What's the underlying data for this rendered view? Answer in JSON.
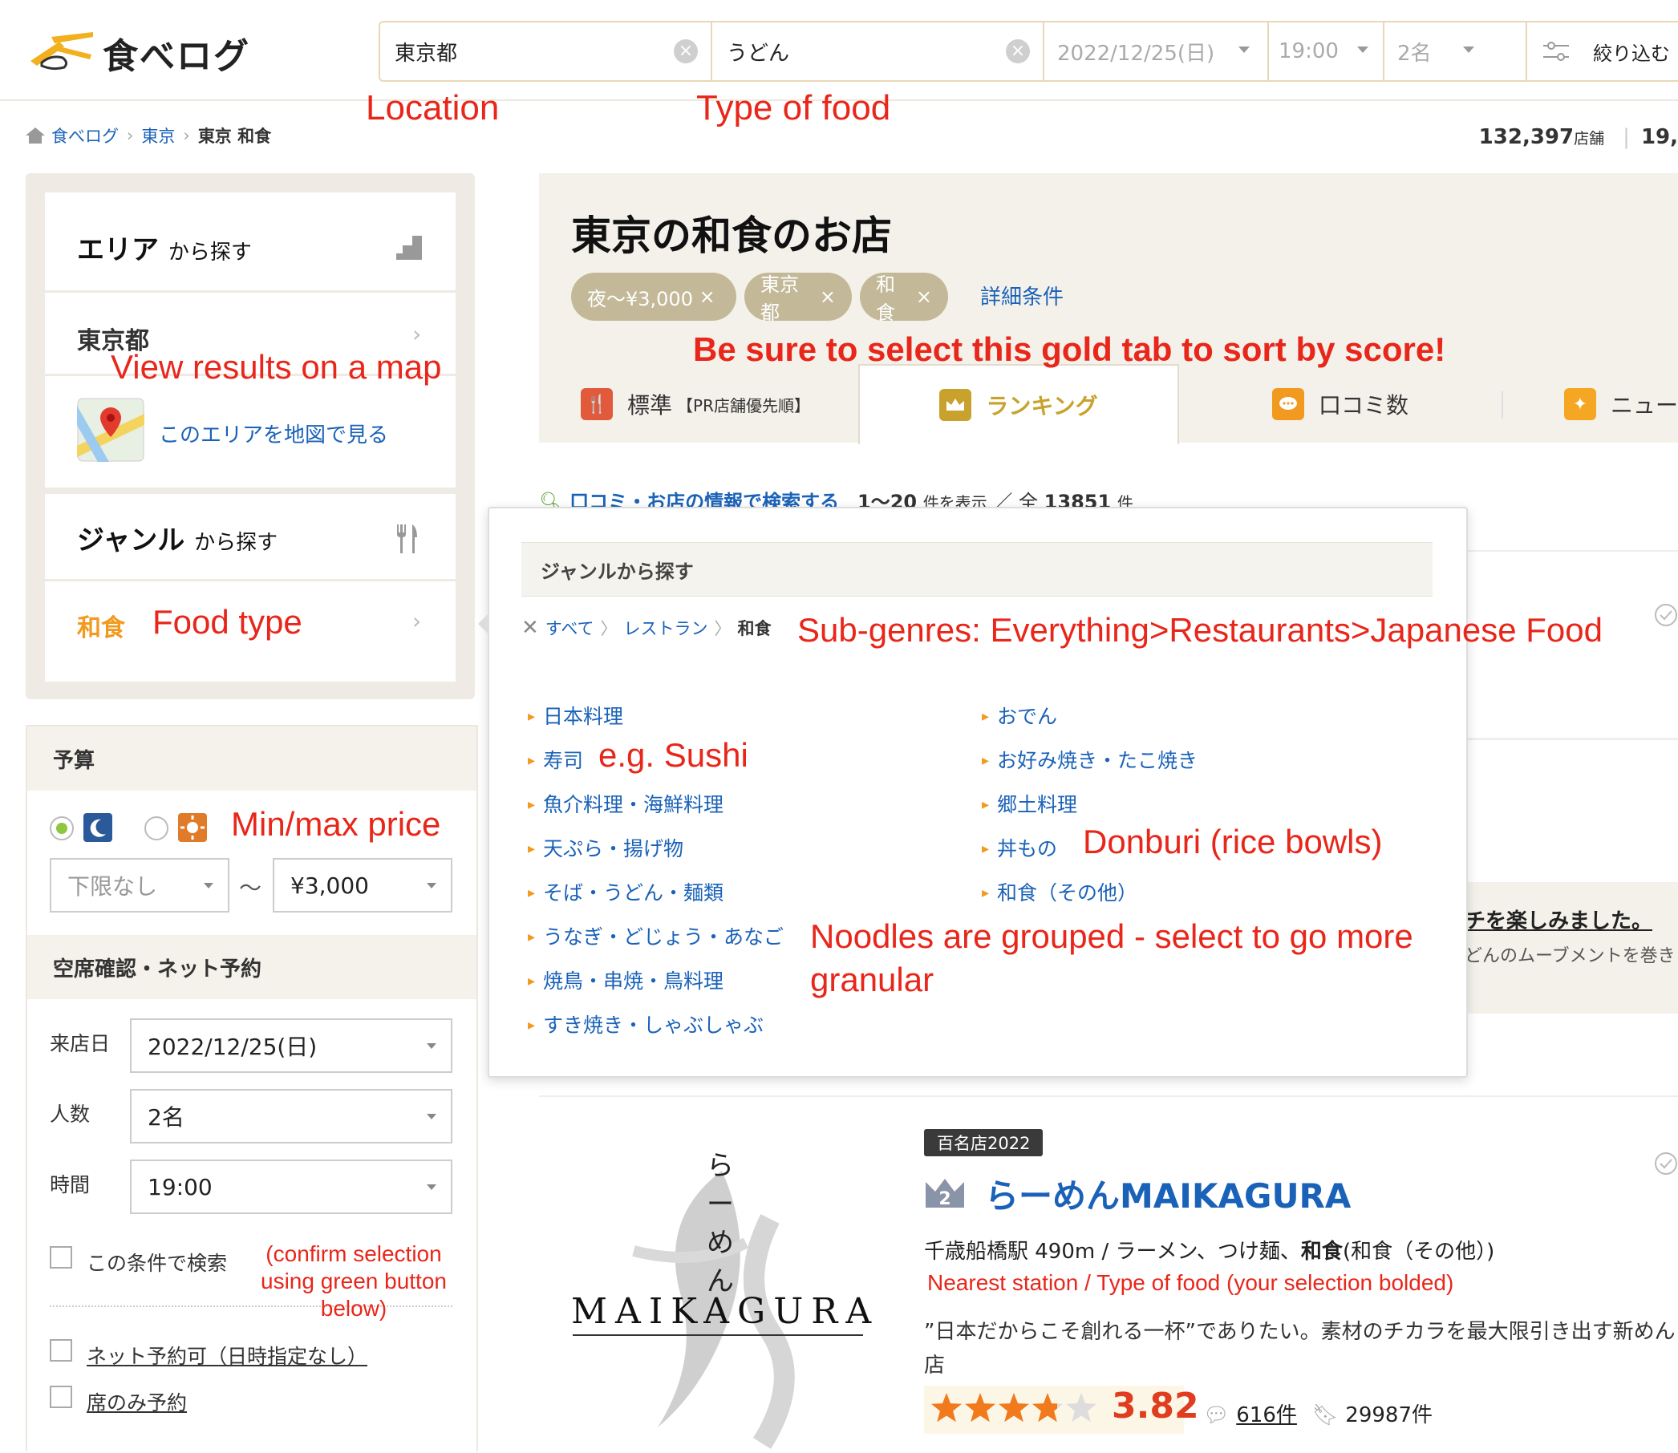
{
  "header": {
    "logo_text": "食べログ",
    "location_value": "東京都",
    "food_value": "うどん",
    "date_value": "2022/12/25(日)",
    "time_value": "19:00",
    "people_value": "2名",
    "filter_label": "絞り込む"
  },
  "breadcrumb": {
    "items": [
      "食べログ",
      "東京",
      "東京 和食"
    ]
  },
  "stats": {
    "store_count": "132,397",
    "store_unit": "店舗",
    "extra": "19,"
  },
  "sidebar": {
    "area_title": "エリア",
    "area_suffix": "から探す",
    "area_value": "東京都",
    "map_link": "このエリアを地図で見る",
    "genre_title": "ジャンル",
    "genre_suffix": "から探す",
    "genre_value": "和食",
    "budget_title": "予算",
    "budget_min": "下限なし",
    "budget_tilde": "〜",
    "budget_max": "¥3,000",
    "reserve_title": "空席確認・ネット予約",
    "date_label": "来店日",
    "date_value": "2022/12/25(日)",
    "people_label": "人数",
    "people_value": "2名",
    "time_label": "時間",
    "time_value": "19:00",
    "check_search": "この条件で検索",
    "check_net": "ネット予約可（日時指定なし）",
    "check_seat": "席のみ予約"
  },
  "main": {
    "title": "東京の和食のお店",
    "chips": [
      "夜〜¥3,000",
      "東京都",
      "和食"
    ],
    "chip_close": "×",
    "detail_link": "詳細条件",
    "tabs": [
      {
        "label": "標準",
        "sub": "【PR店舗優先順】"
      },
      {
        "label": "ランキング"
      },
      {
        "label": "口コミ数"
      },
      {
        "label": "ニュー"
      }
    ],
    "search_link": "口コミ・お店の情報で検索する",
    "range": "1〜20",
    "range_suffix": "件を表示",
    "total_prefix": "／ 全",
    "total": "13851",
    "total_suffix": "件",
    "bg_snippet1": "チを楽しみました。",
    "bg_snippet2": "どんのムーブメントを巻き"
  },
  "popup": {
    "title": "ジャンルから探す",
    "crumbs": [
      "すべて",
      "レストラン",
      "和食"
    ],
    "genres_left": [
      "日本料理",
      "寿司",
      "魚介料理・海鮮料理",
      "天ぷら・揚げ物",
      "そば・うどん・麺類",
      "うなぎ・どじょう・あなご",
      "焼鳥・串焼・鳥料理",
      "すき焼き・しゃぶしゃぶ"
    ],
    "genres_right": [
      "おでん",
      "お好み焼き・たこ焼き",
      "郷土料理",
      "丼もの",
      "和食（その他）"
    ]
  },
  "restaurant": {
    "badge": "百名店2022",
    "rank": "2",
    "name": "らーめんMAIKAGURA",
    "logo_vertical": "らーめん",
    "logo_text": "MAIKAGURA",
    "info_pre": "千歳船橋駅 490m / ラーメン、つけ麺、",
    "info_bold": "和食",
    "info_post": "(和食（その他）)",
    "desc": "”日本だからこそ創れる一杯”でありたい。素材のチカラを最大限引き出す新めん店",
    "rating": 3.82,
    "score": "3.82",
    "reviews": "616件",
    "saves": "29987件"
  },
  "annotations": {
    "location": "Location",
    "type_of_food": "Type of food",
    "view_map": "View results on a map",
    "gold_tab": "Be sure to select this gold tab to sort by score!",
    "food_type": "Food type",
    "sub_genres": "Sub-genres: Everything>Restaurants>Japanese Food",
    "sushi": "e.g. Sushi",
    "donburi": "Donburi (rice bowls)",
    "min_max": "Min/max price",
    "noodles1": "Noodles are grouped - select to go more",
    "noodles2": "granular",
    "confirm1": "(confirm selection",
    "confirm2": "using green button",
    "confirm3": "below)",
    "nearest": "Nearest station / Type of food (your selection bolded)"
  },
  "colors": {
    "link": "#1a62b8",
    "annotation": "#e8261a",
    "chip": "#c3b998",
    "gold": "#c8a22c",
    "score": "#e03c1e"
  }
}
